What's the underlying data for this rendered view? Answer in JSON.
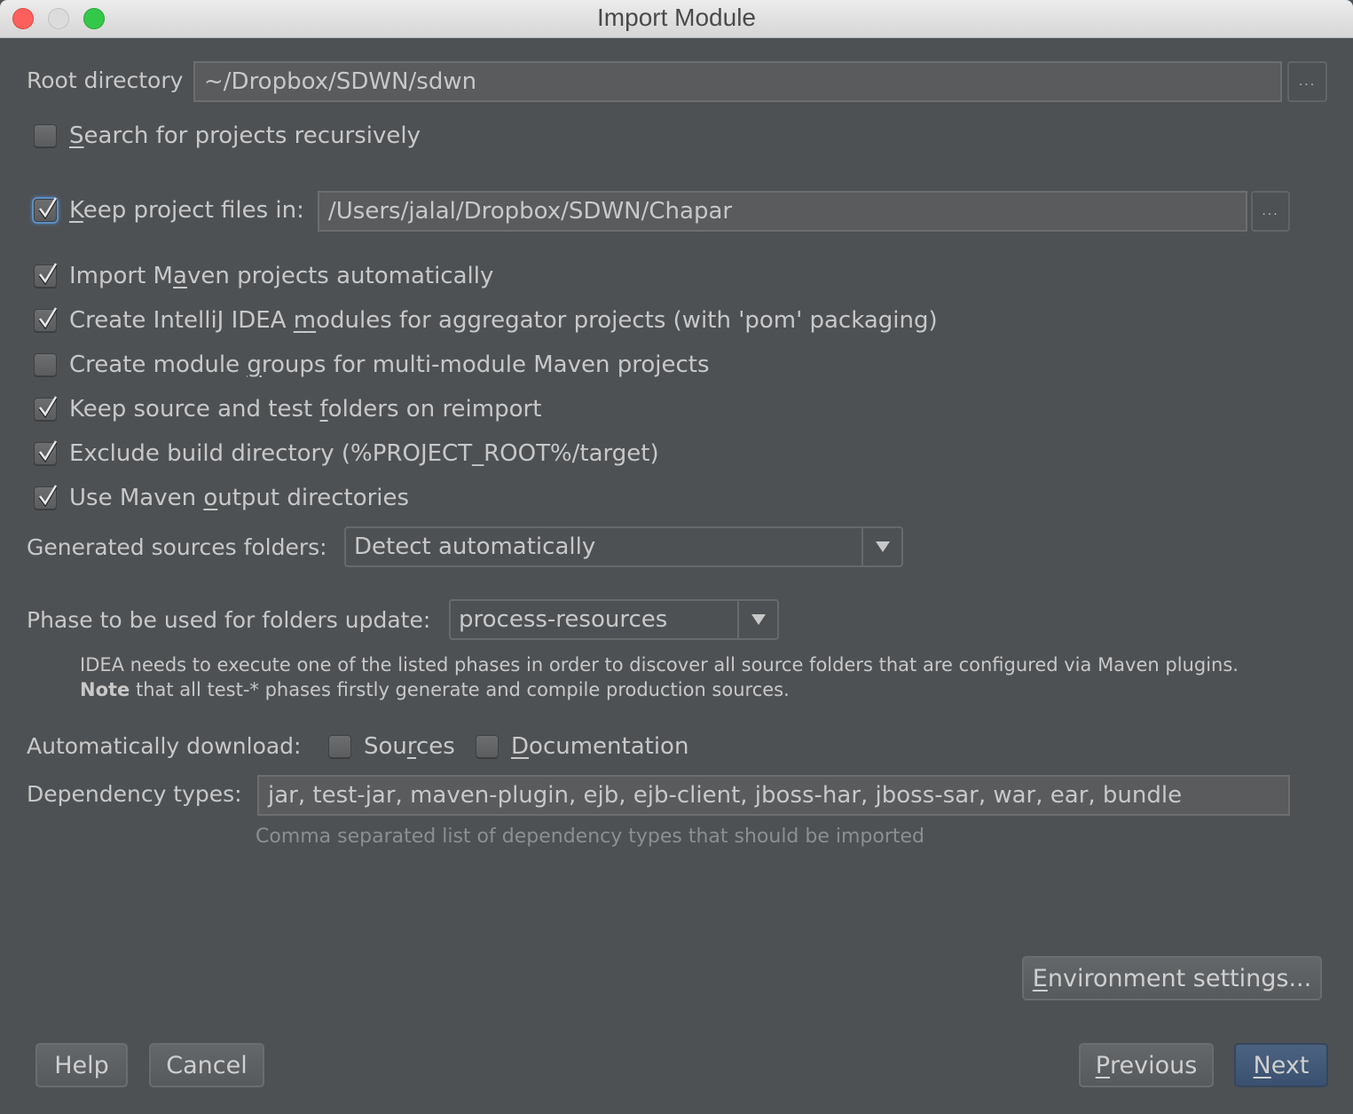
{
  "window": {
    "title": "Import Module",
    "controls": [
      "close",
      "minimize",
      "maximize"
    ]
  },
  "root_directory": {
    "label": "Root directory",
    "value": "~/Dropbox/SDWN/sdwn",
    "browse_label": "..."
  },
  "search_recursively": {
    "label_pre": "",
    "label_mnemonic": "S",
    "label_post": "earch for projects recursively",
    "checked": false
  },
  "keep_project_files": {
    "label_mnemonic": "K",
    "label_post": "eep project files in:",
    "checked": true,
    "value": "/Users/jalal/Dropbox/SDWN/Chapar",
    "browse_label": "..."
  },
  "options": [
    {
      "pre": "Import M",
      "mnemonic": "a",
      "post": "ven projects automatically",
      "checked": true
    },
    {
      "pre": "Create IntelliJ IDEA ",
      "mnemonic": "m",
      "post": "odules for aggregator projects (with 'pom' packaging)",
      "checked": true
    },
    {
      "pre": "Create module ",
      "mnemonic": "g",
      "post": "roups for multi-module Maven projects",
      "checked": false
    },
    {
      "pre": "Keep source and test ",
      "mnemonic": "f",
      "post": "olders on reimport",
      "checked": true
    },
    {
      "pre": "Exclude build directory (%PROJECT_ROOT%/target)",
      "mnemonic": "",
      "post": "",
      "checked": true
    },
    {
      "pre": "Use Maven ",
      "mnemonic": "o",
      "post": "utput directories",
      "checked": true
    }
  ],
  "generated_sources": {
    "label": "Generated sources folders:",
    "selected": "Detect automatically"
  },
  "phase": {
    "label": "Phase to be used for folders update:",
    "selected": "process-resources",
    "note_line1": "IDEA needs to execute one of the listed phases in order to discover all source folders that are configured via Maven plugins.",
    "note_bold": "Note",
    "note_line2": " that all test-* phases firstly generate and compile production sources."
  },
  "auto_download": {
    "label": "Automatically download:",
    "sources": {
      "pre": "Sou",
      "mnemonic": "r",
      "post": "ces",
      "checked": false
    },
    "documentation": {
      "pre": "",
      "mnemonic": "D",
      "post": "ocumentation",
      "checked": false
    }
  },
  "dependency_types": {
    "label": "Dependency types:",
    "value": "jar, test-jar, maven-plugin, ejb, ejb-client, jboss-har, jboss-sar, war, ear, bundle",
    "hint": "Comma separated list of dependency types that should be imported"
  },
  "buttons": {
    "environment": {
      "mnemonic": "E",
      "post": "nvironment settings..."
    },
    "help": "Help",
    "cancel": "Cancel",
    "previous": {
      "mnemonic": "P",
      "post": "revious"
    },
    "next": {
      "mnemonic": "N",
      "post": "ext"
    }
  }
}
